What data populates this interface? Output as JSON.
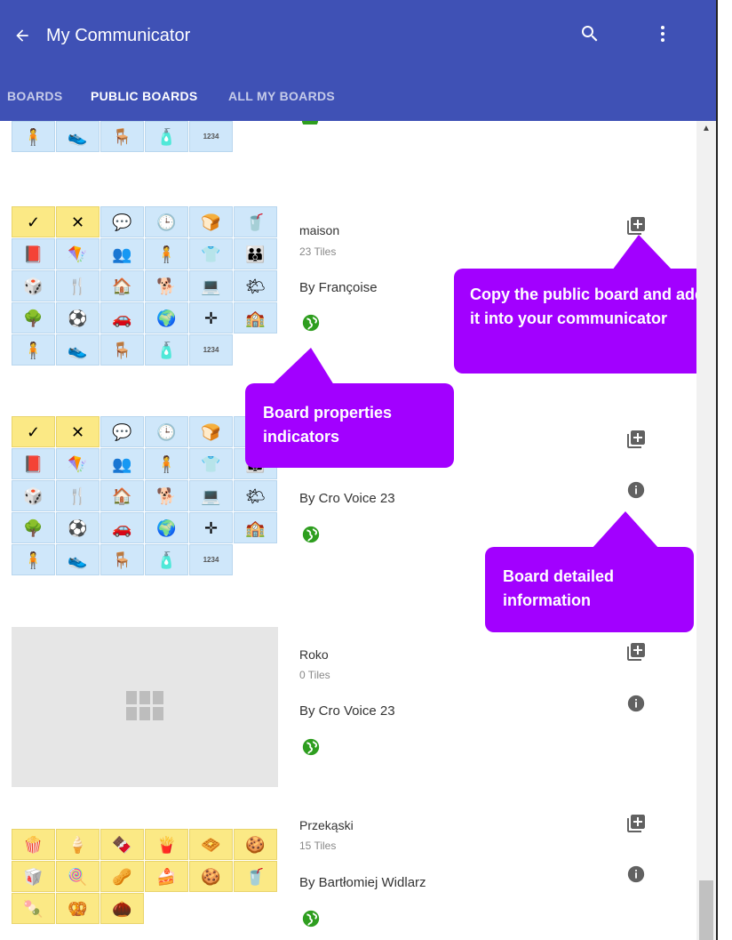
{
  "appbar": {
    "title": "My Communicator",
    "back_icon": "arrow-left-icon",
    "search_icon": "search-icon",
    "menu_icon": "more-vert-icon",
    "color": "#3f51b5"
  },
  "tabs": [
    {
      "label": "BOARDS",
      "active": false
    },
    {
      "label": "PUBLIC BOARDS",
      "active": true
    },
    {
      "label": "ALL MY BOARDS",
      "active": false
    }
  ],
  "boards": [
    {
      "name": "maison",
      "tiles": "23 Tiles",
      "author": "By Françoise"
    },
    {
      "name": "",
      "tiles": "",
      "author": "By Cro Voice 23"
    },
    {
      "name": "Roko",
      "tiles": "0 Tiles",
      "author": "By Cro Voice 23"
    },
    {
      "name": "Przekąski",
      "tiles": "15 Tiles",
      "author": "By Bartłomiej Widlarz"
    }
  ],
  "tile_numbers_label": "1234",
  "callouts": {
    "copy": "Copy the public board and add it into your communicator",
    "properties": "Board properties indicators",
    "details": "Board detailed information"
  },
  "colors": {
    "callout": "#a200ff",
    "globe": "#2e9e1f",
    "tile_blue": "#cfe7fa",
    "tile_yellow": "#fbe985"
  }
}
